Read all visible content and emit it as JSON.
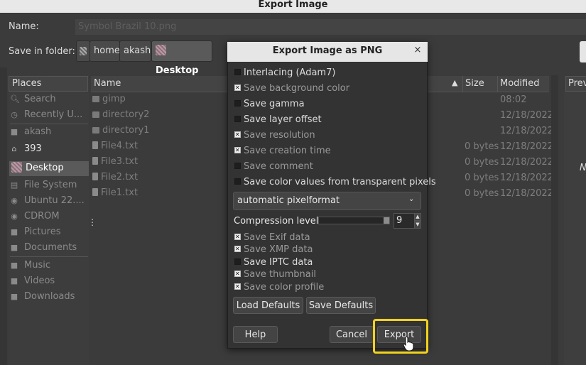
{
  "window": {
    "title": "Export Image"
  },
  "name_row": {
    "label": "Name:",
    "value": "Symbol Brazil 10.png"
  },
  "folder_row": {
    "label": "Save in folder:",
    "crumbs": [
      {
        "label": ""
      },
      {
        "label": "home"
      },
      {
        "label": "akash"
      },
      {
        "label": "Desktop"
      }
    ]
  },
  "places": {
    "header": "Places",
    "items": [
      {
        "label": "Search",
        "icon": "search-icon"
      },
      {
        "label": "Recently U...",
        "icon": "clock-icon"
      },
      {
        "label": "akash",
        "icon": "home-folder-icon"
      },
      {
        "label": "393",
        "icon": "folder-icon"
      },
      {
        "label": "Desktop",
        "icon": "desktop-icon"
      },
      {
        "label": "File System",
        "icon": "drive-icon"
      },
      {
        "label": "Ubuntu 22....",
        "icon": "disc-icon"
      },
      {
        "label": "CDROM",
        "icon": "disc-icon"
      },
      {
        "label": "Pictures",
        "icon": "folder-icon"
      },
      {
        "label": "Documents",
        "icon": "folder-icon"
      },
      {
        "label": "Music",
        "icon": "folder-icon"
      },
      {
        "label": "Videos",
        "icon": "folder-icon"
      },
      {
        "label": "Downloads",
        "icon": "folder-icon"
      }
    ]
  },
  "files": {
    "columns": {
      "name": "Name",
      "size": "Size",
      "modified": "Modified"
    },
    "rows": [
      {
        "name": "gimp",
        "size": "",
        "modified": "08:02",
        "type": "folder"
      },
      {
        "name": "directory2",
        "size": "",
        "modified": "12/18/2022",
        "type": "folder"
      },
      {
        "name": "directory1",
        "size": "",
        "modified": "12/18/2022",
        "type": "folder"
      },
      {
        "name": "File4.txt",
        "size": "0 bytes",
        "modified": "12/18/2022",
        "type": "file"
      },
      {
        "name": "File3.txt",
        "size": "0 bytes",
        "modified": "12/18/2022",
        "type": "file"
      },
      {
        "name": "File2.txt",
        "size": "0 bytes",
        "modified": "12/18/2022",
        "type": "file"
      },
      {
        "name": "File1.txt",
        "size": "0 bytes",
        "modified": "12/18/2022",
        "type": "file"
      }
    ]
  },
  "preview": {
    "header": "Prev",
    "letter": "N"
  },
  "dialog": {
    "title": "Export Image as PNG",
    "close": "×",
    "options": [
      {
        "label": "Interlacing (Adam7)",
        "checked": false
      },
      {
        "label": "Save background color",
        "checked": true
      },
      {
        "label": "Save gamma",
        "checked": false
      },
      {
        "label": "Save layer offset",
        "checked": false
      },
      {
        "label": "Save resolution",
        "checked": true
      },
      {
        "label": "Save creation time",
        "checked": true
      },
      {
        "label": "Save comment",
        "checked": false
      },
      {
        "label": "Save color values from transparent pixels",
        "checked": false
      }
    ],
    "pixelformat": "automatic pixelformat",
    "compression": {
      "label": "Compression level:",
      "value": "9",
      "fraction": 0.9
    },
    "metadata": [
      {
        "label": "Save Exif data",
        "checked": true
      },
      {
        "label": "Save XMP data",
        "checked": true
      },
      {
        "label": "Save IPTC data",
        "checked": false
      },
      {
        "label": "Save thumbnail",
        "checked": true
      },
      {
        "label": "Save color profile",
        "checked": true
      }
    ],
    "buttons": {
      "load_defaults": "Load Defaults",
      "save_defaults": "Save Defaults",
      "help": "Help",
      "cancel": "Cancel",
      "export": "Export"
    }
  }
}
